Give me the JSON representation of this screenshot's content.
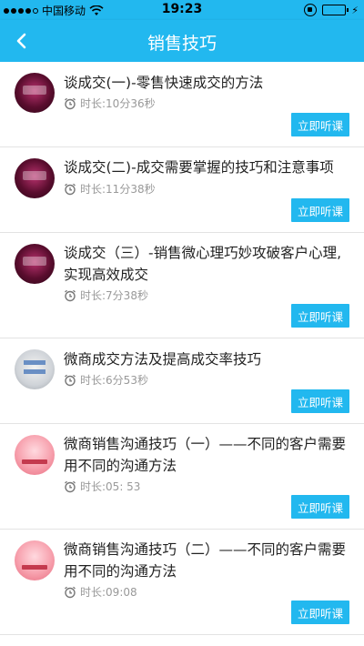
{
  "status_bar": {
    "carrier": "中国移动",
    "time": "19:23"
  },
  "nav": {
    "title": "销售技巧"
  },
  "courses": [
    {
      "title": "谈成交(一)-零售快速成交的方法",
      "duration_label": "时长:",
      "duration": "10分36秒",
      "button": "立即听课",
      "avatar": "dark"
    },
    {
      "title": "谈成交(二)-成交需要掌握的技巧和注意事项",
      "duration_label": "时长:",
      "duration": "11分38秒",
      "button": "立即听课",
      "avatar": "dark"
    },
    {
      "title": "谈成交（三）-销售微心理巧妙攻破客户心理, 实现高效成交",
      "duration_label": "时长:",
      "duration": "7分38秒",
      "button": "立即听课",
      "avatar": "dark"
    },
    {
      "title": "微商成交方法及提高成交率技巧",
      "duration_label": "时长:",
      "duration": "6分53秒",
      "button": "立即听课",
      "avatar": "light"
    },
    {
      "title": "微商销售沟通技巧（一）——不同的客户需要用不同的沟通方法",
      "duration_label": "时长:",
      "duration": "05: 53",
      "button": "立即听课",
      "avatar": "pink"
    },
    {
      "title": "微商销售沟通技巧（二）——不同的客户需要用不同的沟通方法",
      "duration_label": "时长:",
      "duration": "09:08",
      "button": "立即听课",
      "avatar": "pink"
    }
  ],
  "colors": {
    "accent": "#22b8ef",
    "divider": "#e3e3e3",
    "meta_text": "#999999"
  },
  "icons": {
    "back": "chevron-left-icon",
    "clock": "alarm-clock-icon",
    "wifi": "wifi-icon",
    "battery": "battery-icon"
  }
}
